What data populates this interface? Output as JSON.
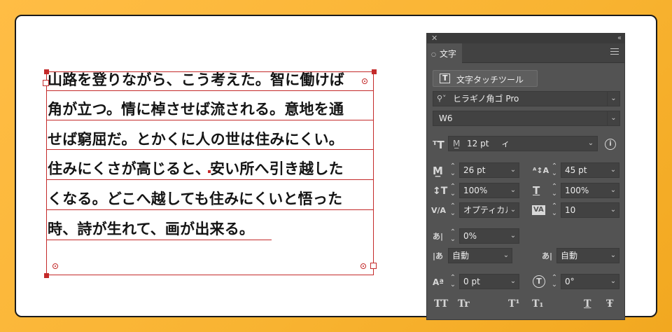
{
  "document": {
    "lines": [
      "山路を登りながら、こう考えた。智に働けば",
      "角が立つ。情に棹させば流される。意地を通",
      "せば窮屈だ。とかくに人の世は住みにくい。",
      "住みにくさが高じると、安い所へ引き越した",
      "くなる。どこへ越しても住みにくいと悟った",
      "時、詩が生れて、画が出来る。"
    ]
  },
  "panel": {
    "tab_label": "文字",
    "touch_tool_label": "文字タッチツール",
    "font_family": "ヒラギノ角ゴ Pro",
    "font_style": "W6",
    "font_size": "12 pt",
    "font_size_suffix": "ィ",
    "leading": "26 pt",
    "kerning_value": "45 pt",
    "vertical_scale": "100%",
    "horizontal_scale": "100%",
    "kerning_method": "オプティカル",
    "tracking": "10",
    "tsume": "0%",
    "aki_left": "自動",
    "aki_right": "自動",
    "baseline_shift": "0 pt",
    "rotation": "0°",
    "style_buttons": [
      "TT",
      "Tr",
      "T¹",
      "T₁",
      "T",
      "Ŧ"
    ]
  },
  "colors": {
    "frame": "#c42a2a",
    "panel_bg": "#535353",
    "background": "#f8b331"
  }
}
